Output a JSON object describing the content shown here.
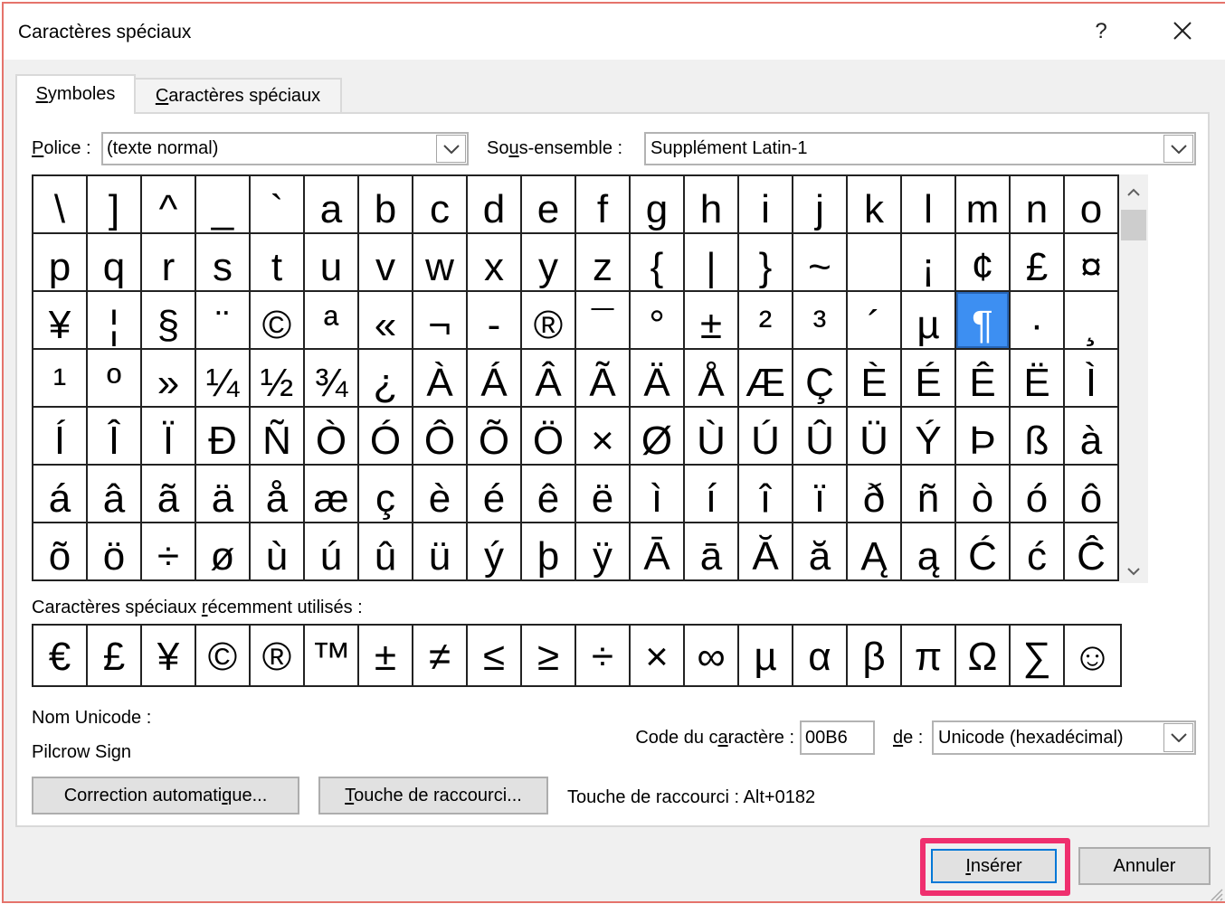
{
  "window": {
    "title": "Caractères spéciaux",
    "help_label": "?"
  },
  "tabs": [
    {
      "label": "Symboles",
      "selected": true
    },
    {
      "label": "Caractères spéciaux",
      "selected": false
    }
  ],
  "font": {
    "label": "Police :",
    "value": "(texte normal)"
  },
  "subset": {
    "label": "Sous-ensemble :",
    "value": "Supplément Latin-1"
  },
  "symbol_grid": {
    "rows": [
      [
        "\\",
        "]",
        "^",
        "_",
        "`",
        "a",
        "b",
        "c",
        "d",
        "e",
        "f",
        "g",
        "h",
        "i",
        "j",
        "k",
        "l",
        "m",
        "n",
        "o"
      ],
      [
        "p",
        "q",
        "r",
        "s",
        "t",
        "u",
        "v",
        "w",
        "x",
        "y",
        "z",
        "{",
        "|",
        "}",
        "~",
        " ",
        "¡",
        "¢",
        "£",
        "¤"
      ],
      [
        "¥",
        "¦",
        "§",
        "¨",
        "©",
        "ª",
        "«",
        "¬",
        "-",
        "®",
        "¯",
        "°",
        "±",
        "²",
        "³",
        "´",
        "µ",
        "¶",
        "·",
        "¸"
      ],
      [
        "¹",
        "º",
        "»",
        "¼",
        "½",
        "¾",
        "¿",
        "À",
        "Á",
        "Â",
        "Ã",
        "Ä",
        "Å",
        "Æ",
        "Ç",
        "È",
        "É",
        "Ê",
        "Ë",
        "Ì"
      ],
      [
        "Í",
        "Î",
        "Ï",
        "Ð",
        "Ñ",
        "Ò",
        "Ó",
        "Ô",
        "Õ",
        "Ö",
        "×",
        "Ø",
        "Ù",
        "Ú",
        "Û",
        "Ü",
        "Ý",
        "Þ",
        "ß",
        "à"
      ],
      [
        "á",
        "â",
        "ã",
        "ä",
        "å",
        "æ",
        "ç",
        "è",
        "é",
        "ê",
        "ë",
        "ì",
        "í",
        "î",
        "ï",
        "ð",
        "ñ",
        "ò",
        "ó",
        "ô"
      ],
      [
        "õ",
        "ö",
        "÷",
        "ø",
        "ù",
        "ú",
        "û",
        "ü",
        "ý",
        "þ",
        "ÿ",
        "Ā",
        "ā",
        "Ă",
        "ă",
        "Ą",
        "ą",
        "Ć",
        "ć",
        "Ĉ"
      ]
    ]
  },
  "recent": {
    "label": "Caractères spéciaux récemment utilisés :",
    "symbols": [
      "€",
      "£",
      "¥",
      "©",
      "®",
      "™",
      "±",
      "≠",
      "≤",
      "≥",
      "÷",
      "×",
      "∞",
      "µ",
      "α",
      "β",
      "π",
      "Ω",
      "∑",
      "☺"
    ]
  },
  "unicode_name": {
    "label": "Nom Unicode :",
    "value": "Pilcrow Sign"
  },
  "char_code": {
    "label": "Code du caractère :",
    "value": "00B6"
  },
  "code_from": {
    "label": "de :",
    "value": "Unicode (hexadécimal)"
  },
  "buttons": {
    "autocorrect": "Correction automatique...",
    "shortcut_key": "Touche de raccourci...",
    "insert": "Insérer",
    "cancel": "Annuler"
  },
  "shortcut": {
    "text": "Touche de raccourci : Alt+0182"
  },
  "icons": {
    "close": "close-icon",
    "dropdown": "chevron-down-icon",
    "scroll_up": "chevron-up-icon",
    "scroll_down": "chevron-down-icon",
    "resize": "resize-grip-icon"
  },
  "colors": {
    "selection": "#3d8ff2",
    "highlight_box": "#ef2f6e",
    "default_button_border": "#0078d7",
    "window_border": "#e5736b"
  }
}
